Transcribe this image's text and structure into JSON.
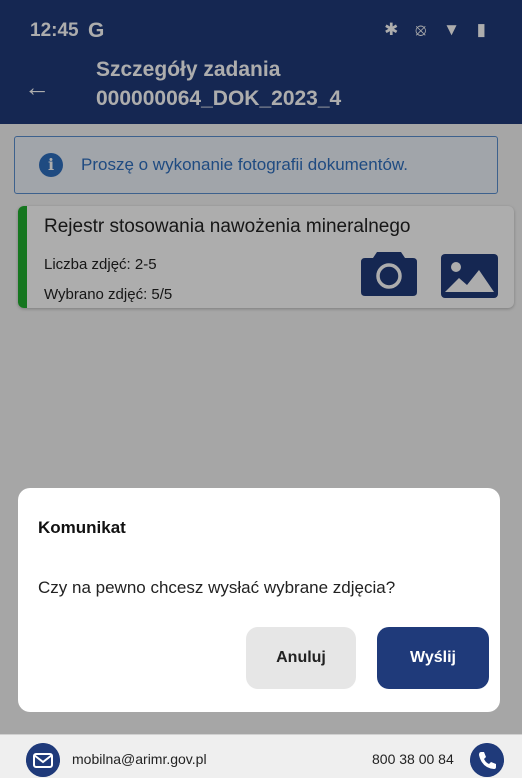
{
  "status": {
    "time": "12:45",
    "g": "G",
    "icons": "✱ ⦻ ▼ ▮"
  },
  "appbar": {
    "back": "←",
    "title_line1": "Szczegóły zadania",
    "title_line2": "000000064_DOK_2023_4"
  },
  "info": {
    "icon": "i",
    "text": "Proszę o wykonanie fotografii dokumentów."
  },
  "card": {
    "title": "Rejestr stosowania nawożenia mineralnego",
    "count": "Liczba zdjęć: 2-5",
    "selected": "Wybrano zdjęć: 5/5",
    "accent_color": "#1fae2f"
  },
  "dialog": {
    "title": "Komunikat",
    "message": "Czy na pewno chcesz wysłać wybrane zdjęcia?",
    "cancel_label": "Anuluj",
    "send_label": "Wyślij"
  },
  "footer": {
    "email": "mobilna@arimr.gov.pl",
    "phone": "800 38 00 84"
  },
  "colors": {
    "primary": "#1f3a7a",
    "info": "#2f6fbf"
  }
}
